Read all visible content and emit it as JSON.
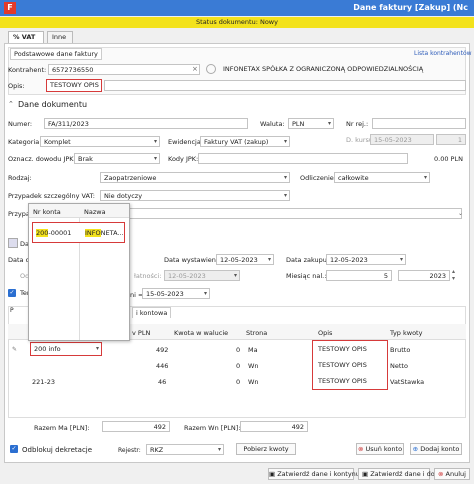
{
  "title_bar": {
    "title": "Dane faktury [Zakup] (Nc",
    "logo": "F"
  },
  "status_bar": {
    "text": "Status dokumentu: Nowy"
  },
  "tabs": [
    {
      "label": "% VAT"
    },
    {
      "label": "Inne"
    }
  ],
  "basic": {
    "tab_label": "Podstawowe dane faktury",
    "link": "Lista kontrahentów",
    "kontrahent_label": "Kontrahent:",
    "kontrahent_value": "6572736550",
    "kontrahent_name": "INFONETAX SPÓŁKA Z OGRANICZONĄ ODPOWIEDZIALNOŚCIĄ",
    "opis_label": "Opis:",
    "opis_value": "TESTOWY OPIS"
  },
  "doc": {
    "header": "Dane dokumentu",
    "numer_label": "Numer:",
    "numer_value": "FA/311/2023",
    "waluta_label": "Waluta:",
    "waluta_value": "PLN",
    "nr_rej_label": "Nr rej.:",
    "kurs_label": "D. kursu",
    "kurs_date": "15-05-2023",
    "kurs_value": "1",
    "kategoria_label": "Kategoria:",
    "kategoria_value": "Komplet",
    "ewidencja_label": "Ewidencja:",
    "ewidencja_value": "Faktury VAT (zakup)",
    "oznacz_label": "Oznacz. dowodu JPK:",
    "oznacz_value": "Brak",
    "kody_label": "Kody JPK:",
    "kody_amount": "0.00 PLN",
    "rodzaj_label": "Rodzaj:",
    "rodzaj_value": "Zaopatrzeniowe",
    "odliczenie_label": "Odliczenie:",
    "odliczenie_value": "całkowite",
    "przypadek_label": "Przypadek szczególny VAT:",
    "przypadek_value": "Nie dotyczy",
    "przyp_label": "Przypa"
  },
  "dates": {
    "data_label": "Data o",
    "wystawienia_label": "Data wystawienia:",
    "wystawienia_value": "12-05-2023",
    "zakupu_label": "Data zakupu:",
    "zakupu_value": "12-05-2023",
    "odl_label": "Odl",
    "platnosci_label": "łatności:",
    "platnosci_value": "12-05-2023",
    "miesiac_label": "Miesiąc nal.:",
    "miesiac_value": "5",
    "rok_value": "2023",
    "ter_label": "Ter",
    "term_label": "ni =",
    "term_value": "15-05-2023"
  },
  "popup": {
    "col1": "Nr konta",
    "col2": "Nazwa",
    "row_nr_hl": "200",
    "row_nr_rest": "-00001",
    "row_name_hl": "INFO",
    "row_name_rest": "NETA..."
  },
  "postings": {
    "tab_label": "i kontowa",
    "tab_p": "P",
    "headers": [
      "v PLN",
      "Kwota w walucie",
      "Strona",
      "Opis",
      "Typ kwoty"
    ],
    "input_value": "200 info",
    "rows": [
      {
        "konto": "",
        "pln": "492",
        "wal": "0",
        "strona": "Ma",
        "opis": "TESTOWY OPIS",
        "typ": "Brutto"
      },
      {
        "konto": "",
        "pln": "446",
        "wal": "0",
        "strona": "Wn",
        "opis": "TESTOWY OPIS",
        "typ": "Netto"
      },
      {
        "konto": "221-23",
        "pln": "46",
        "wal": "0",
        "strona": "Wn",
        "opis": "TESTOWY OPIS",
        "typ": "VatStawka"
      }
    ]
  },
  "totals": {
    "ma_label": "Razem Ma [PLN]:",
    "ma_value": "492",
    "wn_label": "Razem Wn [PLN]:",
    "wn_value": "492"
  },
  "bottom": {
    "odblokuj_label": "Odblokuj dekretacje",
    "rejestr_label": "Rejestr:",
    "rejestr_value": "RKZ",
    "pobierz_label": "Pobierz kwoty",
    "usun_label": "Usuń konto",
    "dodaj_label": "Dodaj konto"
  },
  "footer": {
    "zatwierdz_kont": "Zatwierdź dane i kontynuuj",
    "zatwierdz_dod": "Zatwierdź dane i dod",
    "anuluj": "Anuluj"
  }
}
